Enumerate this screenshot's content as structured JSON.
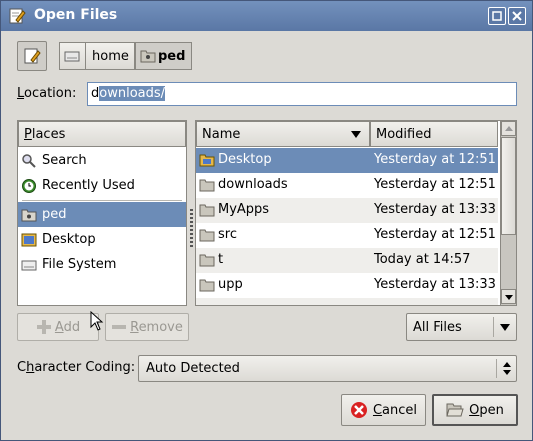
{
  "window": {
    "title": "Open Files"
  },
  "path": {
    "home": "home",
    "current": "ped"
  },
  "location": {
    "label_pre": "",
    "label_accel": "L",
    "label_post": "ocation:",
    "value": "downloads/",
    "caret_char": "d",
    "selected_part": "ownloads/"
  },
  "places": {
    "header_accel": "P",
    "header_rest": "laces",
    "items": [
      {
        "label": "Search",
        "icon": "search-icon"
      },
      {
        "label": "Recently Used",
        "icon": "clock-icon"
      },
      {
        "label": "ped",
        "icon": "home-folder-icon"
      },
      {
        "label": "Desktop",
        "icon": "desktop-icon"
      },
      {
        "label": "File System",
        "icon": "drive-icon"
      }
    ]
  },
  "files": {
    "col_name": "Name",
    "col_modified": "Modified",
    "rows": [
      {
        "name": "Desktop",
        "modified": "Yesterday at 12:51",
        "selected": true
      },
      {
        "name": "downloads",
        "modified": "Yesterday at 12:51"
      },
      {
        "name": "MyApps",
        "modified": "Yesterday at 13:33"
      },
      {
        "name": "src",
        "modified": "Yesterday at 12:51"
      },
      {
        "name": "t",
        "modified": "Today at 14:57"
      },
      {
        "name": "upp",
        "modified": "Yesterday at 13:33"
      }
    ]
  },
  "buttons": {
    "add_accel": "A",
    "add_rest": "dd",
    "remove_accel": "R",
    "remove_rest": "emove",
    "cancel_accel": "C",
    "cancel_rest": "ancel",
    "open_accel": "O",
    "open_rest": "pen"
  },
  "filter": {
    "value": "All Files"
  },
  "coding": {
    "label_pre": "C",
    "label_accel": "h",
    "label_post": "aracter Coding:",
    "value": "Auto Detected"
  },
  "colors": {
    "titlebar": "#5f7cab",
    "selection": "#6c8cb7",
    "window_bg": "#dcdad5"
  }
}
